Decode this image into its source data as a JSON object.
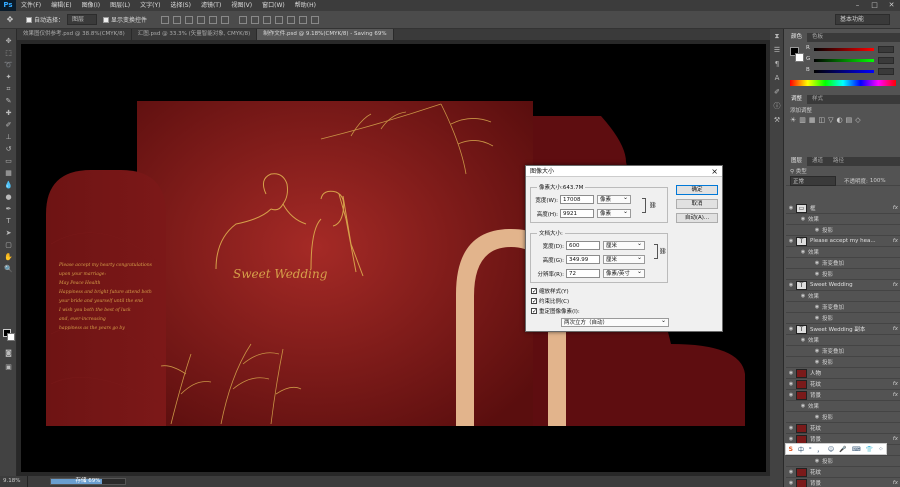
{
  "app": {
    "logo": "Ps"
  },
  "menu": [
    "文件(F)",
    "编辑(E)",
    "图像(I)",
    "图层(L)",
    "文字(Y)",
    "选择(S)",
    "滤镜(T)",
    "视图(V)",
    "窗口(W)",
    "帮助(H)"
  ],
  "window_controls": [
    "–",
    "□",
    "✕"
  ],
  "options": {
    "auto_select_label": "自动选择：",
    "auto_select_value": "图层",
    "show_transform_label": "显示变换控件",
    "workspace": "基本功能"
  },
  "tabs": [
    "效果图仅供参考.psd @ 38.8%(CMYK/8)",
    "汇图.psd @ 33.3% (矢量智能对象, CMYK/8)",
    "制作文件.psd @ 9.18%(CMYK/8) - Saving 69%"
  ],
  "status": {
    "zoom": "9.18%",
    "progress_label": "存储 69%",
    "progress": 0.69
  },
  "design": {
    "left_text": [
      "Please accept my hearty congratulations",
      "upon your marriage:",
      "May Peace Health",
      "Happiness and bright future attend both",
      "your bride and yourself until the end",
      "I wish you both the best of luck",
      "and, ever-increasing",
      "happiness as the years go by"
    ],
    "title": "Sweet Wedding"
  },
  "dialog": {
    "title": "图像大小",
    "pixel_label": "像素大小:643.7M",
    "width_label": "宽度(W):",
    "width_val": "17008",
    "width_unit": "像素",
    "height_label": "高度(H):",
    "height_val": "9921",
    "height_unit": "像素",
    "doc_label": "文档大小:",
    "dw_label": "宽度(D):",
    "dw_val": "600",
    "dw_unit": "厘米",
    "dh_label": "高度(G):",
    "dh_val": "349.99",
    "dh_unit": "厘米",
    "res_label": "分辨率(R):",
    "res_val": "72",
    "res_unit": "像素/英寸",
    "ok": "确定",
    "cancel": "取消",
    "auto": "自动(A)...",
    "cb1": "缩放样式(Y)",
    "cb2": "约束比例(C)",
    "cb3": "重定图像像素(I):",
    "resample": "两次立方（自动）"
  },
  "color_panel": {
    "tabs": [
      "颜色",
      "色板"
    ],
    "r": "R",
    "g": "G",
    "b": "B",
    "colors": {
      "fg": "#000000",
      "bg": "#ffffff"
    }
  },
  "adjust_panel": {
    "tabs": [
      "调整",
      "样式"
    ],
    "title": "添加调整"
  },
  "layers_panel": {
    "tabs": [
      "图层",
      "通道",
      "路径"
    ],
    "kind": "正常",
    "opacity_label": "不透明度:",
    "opacity_val": "100%"
  },
  "layers": [
    {
      "name": "框",
      "type": "group",
      "fx": "fx"
    },
    {
      "name": "效果",
      "type": "sub"
    },
    {
      "name": "投影",
      "type": "sub2"
    },
    {
      "name": "Please accept my hea...",
      "type": "text",
      "fx": "fx"
    },
    {
      "name": "效果",
      "type": "sub"
    },
    {
      "name": "渐变叠加",
      "type": "sub2"
    },
    {
      "name": "投影",
      "type": "sub2"
    },
    {
      "name": "Sweet  Wedding",
      "type": "text",
      "fx": "fx"
    },
    {
      "name": "效果",
      "type": "sub"
    },
    {
      "name": "渐变叠加",
      "type": "sub2"
    },
    {
      "name": "投影",
      "type": "sub2"
    },
    {
      "name": "Sweet  Wedding 副本",
      "type": "text",
      "fx": "fx"
    },
    {
      "name": "效果",
      "type": "sub"
    },
    {
      "name": "渐变叠加",
      "type": "sub2"
    },
    {
      "name": "投影",
      "type": "sub2"
    },
    {
      "name": "人物",
      "type": "img"
    },
    {
      "name": "花纹",
      "type": "img",
      "fx": "fx"
    },
    {
      "name": "背景",
      "type": "img",
      "fx": "fx"
    },
    {
      "name": "效果",
      "type": "sub"
    },
    {
      "name": "投影",
      "type": "sub2"
    },
    {
      "name": "花纹",
      "type": "img"
    },
    {
      "name": "背景",
      "type": "img",
      "fx": "fx"
    },
    {
      "name": "效果",
      "type": "sub"
    },
    {
      "name": "投影",
      "type": "sub2"
    },
    {
      "name": "花纹",
      "type": "img"
    },
    {
      "name": "背景",
      "type": "img",
      "fx": "fx"
    }
  ],
  "ime": [
    "S",
    "中",
    "ᵒ",
    "，",
    "☺",
    "🎤",
    "⌨",
    "👕",
    "⁘"
  ]
}
